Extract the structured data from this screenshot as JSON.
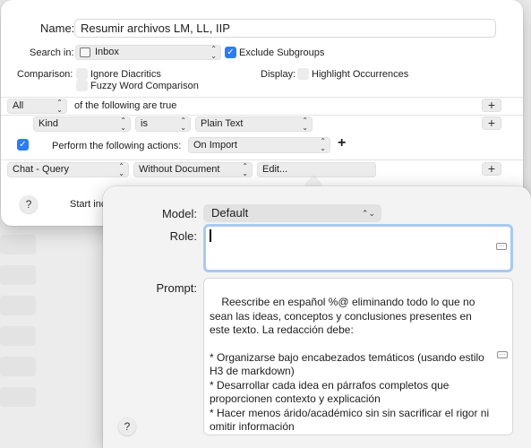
{
  "rule": {
    "name_label": "Name:",
    "name_value": "Resumir archivos LM, LL, IIP",
    "search_in_label": "Search in:",
    "search_in_value": "Inbox",
    "exclude_subgroups_label": "Exclude Subgroups",
    "comparison_label": "Comparison:",
    "ignore_diacritics_label": "Ignore Diacritics",
    "fuzzy_label": "Fuzzy Word Comparison",
    "display_label": "Display:",
    "highlight_label": "Highlight Occurrences"
  },
  "conditions": {
    "match_value": "All",
    "match_suffix": "of the following are true",
    "field_value": "Kind",
    "operator_value": "is",
    "kind_value": "Plain Text"
  },
  "actions": {
    "perform_label": "Perform the following actions:",
    "trigger_value": "On Import",
    "action_value": "Chat - Query",
    "document_value": "Without Document",
    "edit_label": "Edit...",
    "start_label": "Start inc"
  },
  "popover": {
    "model_label": "Model:",
    "model_value": "Default",
    "role_label": "Role:",
    "role_value": "",
    "prompt_label": "Prompt:",
    "prompt_value": "Reescribe en español %@ eliminando todo lo que no sean las ideas, conceptos y conclusiones presentes en este texto. La redacción debe:\n\n* Organizarse bajo encabezados temáticos (usando estilo H3 de markdown)\n* Desarrollar cada idea en párrafos completos que proporcionen contexto y explicación\n* Hacer menos árido/académico sin sin sacrificar el rigor ni omitir información\n* Usar listas sólo para elementos verdaderamente"
  },
  "icons": {
    "help": "?",
    "plus": "+",
    "checkmark": "✓",
    "chevron": "⌃⌄"
  },
  "colors": {
    "accent": "#2b7cf6",
    "focus_ring": "#a9c8f3"
  }
}
